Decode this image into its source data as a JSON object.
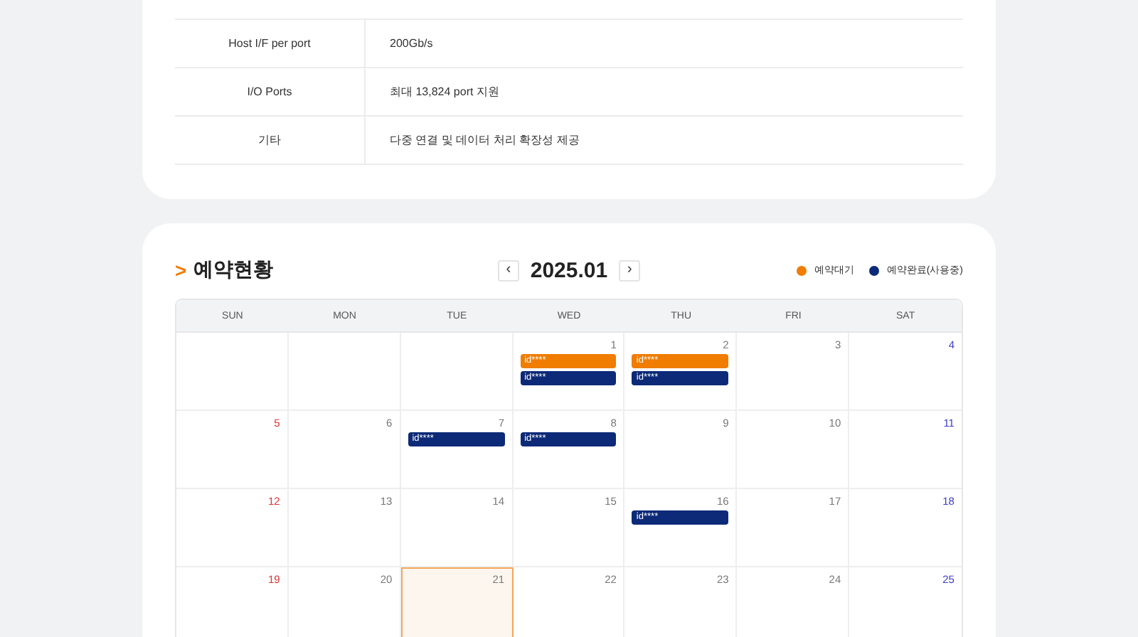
{
  "spec_table": {
    "rows": [
      {
        "label": "Host I/F per port",
        "value": "200Gb/s"
      },
      {
        "label": "I/O Ports",
        "value": "최대 13,824 port 지원"
      },
      {
        "label": "기타",
        "value": "다중 연결 및 데이터 처리 확장성 제공"
      }
    ]
  },
  "reservations": {
    "title": "예약현황",
    "title_mark": ">",
    "month": "2025.01",
    "prev": "‹",
    "next": "›",
    "legend": [
      {
        "label": "예약대기",
        "color": "#f07c00"
      },
      {
        "label": "예약완료(사용중)",
        "color": "#0c2a78"
      }
    ],
    "weekdays": [
      "SUN",
      "MON",
      "TUE",
      "WED",
      "THU",
      "FRI",
      "SAT"
    ],
    "weeks": [
      [
        {
          "selected": false
        },
        {
          "selected": false
        },
        {
          "selected": false
        },
        {
          "day": "1",
          "selected": false,
          "events": [
            {
              "label": "id****",
              "color": "#f07c00"
            },
            {
              "label": "id****",
              "color": "#0c2a78"
            }
          ]
        },
        {
          "day": "2",
          "selected": false,
          "events": [
            {
              "label": "id****",
              "color": "#f07c00"
            },
            {
              "label": "id****",
              "color": "#0c2a78"
            }
          ]
        },
        {
          "day": "3",
          "selected": false
        },
        {
          "day": "4",
          "selected": false
        }
      ],
      [
        {
          "day": "5",
          "selected": false
        },
        {
          "day": "6",
          "selected": false
        },
        {
          "day": "7",
          "selected": false,
          "events": [
            {
              "label": "id****",
              "color": "#0c2a78"
            }
          ]
        },
        {
          "day": "8",
          "selected": false,
          "events": [
            {
              "label": "id****",
              "color": "#0c2a78"
            }
          ]
        },
        {
          "day": "9",
          "selected": false
        },
        {
          "day": "10",
          "selected": false
        },
        {
          "day": "11",
          "selected": false
        }
      ],
      [
        {
          "day": "12",
          "selected": false
        },
        {
          "day": "13",
          "selected": false
        },
        {
          "day": "14",
          "selected": false
        },
        {
          "day": "15",
          "selected": false
        },
        {
          "day": "16",
          "selected": false,
          "events": [
            {
              "label": "id****",
              "color": "#0c2a78"
            }
          ]
        },
        {
          "day": "17",
          "selected": false
        },
        {
          "day": "18",
          "selected": false
        }
      ],
      [
        {
          "day": "19",
          "selected": false
        },
        {
          "day": "20",
          "selected": false
        },
        {
          "day": "21",
          "selected": true
        },
        {
          "day": "22",
          "selected": false
        },
        {
          "day": "23",
          "selected": false
        },
        {
          "day": "24",
          "selected": false
        },
        {
          "day": "25",
          "selected": false
        }
      ]
    ]
  }
}
